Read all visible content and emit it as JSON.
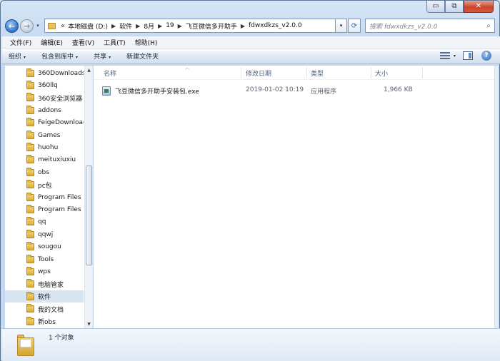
{
  "window": {
    "caption_buttons": {
      "minimize": "▭",
      "maximize": "⧉",
      "close": "✕"
    }
  },
  "nav": {
    "back_glyph": "←",
    "forward_glyph": "→",
    "history_glyph": "▾",
    "overflow": "«",
    "breadcrumb": [
      "本地磁盘 (D:)",
      "软件",
      "8月",
      "19",
      "飞豆微信多开助手",
      "fdwxdkzs_v2.0.0"
    ],
    "breadcrumb_sep": "▶",
    "refresh_glyph": "⟳"
  },
  "search": {
    "placeholder": "搜索 fdwxdkzs_v2.0.0",
    "icon": "magnifier-icon",
    "icon_glyph": "⌕"
  },
  "menubar": {
    "items": [
      "文件(F)",
      "编辑(E)",
      "查看(V)",
      "工具(T)",
      "帮助(H)"
    ]
  },
  "toolbar": {
    "organize": "组织",
    "include_in_library": "包含到库中",
    "share": "共享",
    "new_folder": "新建文件夹",
    "help_glyph": "?"
  },
  "sidebar": {
    "items": [
      "360Downloads",
      "360llq",
      "360安全浏览器",
      "addons",
      "FeigeDownload",
      "Games",
      "huohu",
      "meituxiuxiu",
      "obs",
      "pc包",
      "Program Files",
      "Program Files",
      "qq",
      "qqwj",
      "sougou",
      "Tools",
      "wps",
      "电脑管家",
      "软件",
      "我的文档",
      "新obs"
    ],
    "selected_index": 18
  },
  "columns": {
    "name": "名称",
    "modified": "修改日期",
    "type": "类型",
    "size": "大小"
  },
  "files": [
    {
      "name": "飞豆微信多开助手安装包.exe",
      "modified": "2019-01-02 10:19",
      "type": "应用程序",
      "size": "1,966 KB"
    }
  ],
  "details": {
    "count": "1 个对象"
  },
  "colors": {
    "frame": "#c4d8ef",
    "selection": "#d9e4f3",
    "folder": "#e9c45a"
  }
}
